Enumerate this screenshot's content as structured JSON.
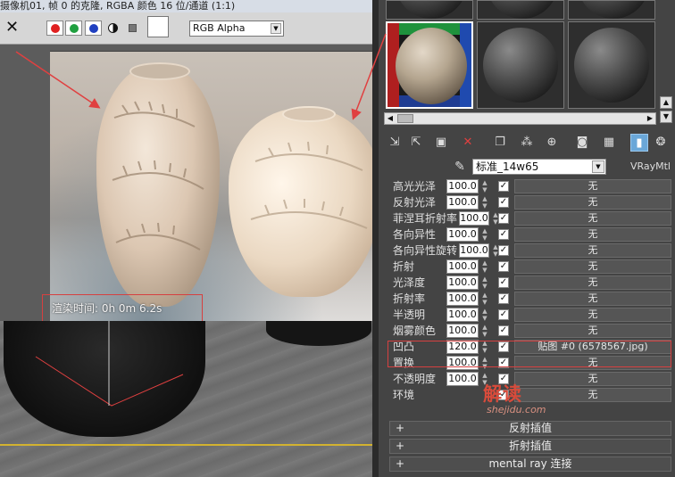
{
  "render_window": {
    "title": "摄像机01, 帧 0 的克隆, RGBA 颜色 16 位/通道 (1:1)",
    "channel_select": "RGB Alpha",
    "render_time": "渲染时间: 0h 0m 6.2s",
    "swatch_colors": {
      "red": "#e02020",
      "green": "#20a040",
      "blue": "#2040c0"
    }
  },
  "material_editor": {
    "material_name": "标准_14w65",
    "material_type": "VRayMtl",
    "toolbar_icons": [
      "get-material-icon",
      "put-to-scene-icon",
      "assign-to-selection-icon",
      "reset-map-icon",
      "make-copy-icon",
      "make-unique-icon",
      "put-to-library-icon",
      "material-id-icon",
      "show-map-icon",
      "show-end-result-icon",
      "go-to-parent-icon"
    ],
    "params": [
      {
        "label": "高光光泽",
        "value": "100.0",
        "checked": true,
        "map": "无"
      },
      {
        "label": "反射光泽",
        "value": "100.0",
        "checked": true,
        "map": "无"
      },
      {
        "label": "菲涅耳折射率",
        "value": "100.0",
        "checked": true,
        "map": "无"
      },
      {
        "label": "各向异性",
        "value": "100.0",
        "checked": true,
        "map": "无"
      },
      {
        "label": "各向异性旋转",
        "value": "100.0",
        "checked": true,
        "map": "无"
      },
      {
        "label": "折射",
        "value": "100.0",
        "checked": true,
        "map": "无"
      },
      {
        "label": "光泽度",
        "value": "100.0",
        "checked": true,
        "map": "无"
      },
      {
        "label": "折射率",
        "value": "100.0",
        "checked": true,
        "map": "无"
      },
      {
        "label": "半透明",
        "value": "100.0",
        "checked": true,
        "map": "无"
      },
      {
        "label": "烟雾颜色",
        "value": "100.0",
        "checked": true,
        "map": "无"
      },
      {
        "label": "凹凸",
        "value": "120.0",
        "checked": true,
        "map": "贴图 #0 (6578567.jpg)"
      },
      {
        "label": "置换",
        "value": "100.0",
        "checked": true,
        "map": "无"
      },
      {
        "label": "不透明度",
        "value": "100.0",
        "checked": true,
        "map": "无"
      },
      {
        "label": "环境",
        "value": "",
        "checked": true,
        "map": "无"
      }
    ],
    "rollouts": [
      "反射插值",
      "折射插值",
      "mental ray 连接"
    ]
  },
  "watermark": {
    "main": "解读",
    "sub": "shejidu.com"
  },
  "colors": {
    "highlight": "#d64040",
    "active_tool": "#6aa7d8"
  }
}
